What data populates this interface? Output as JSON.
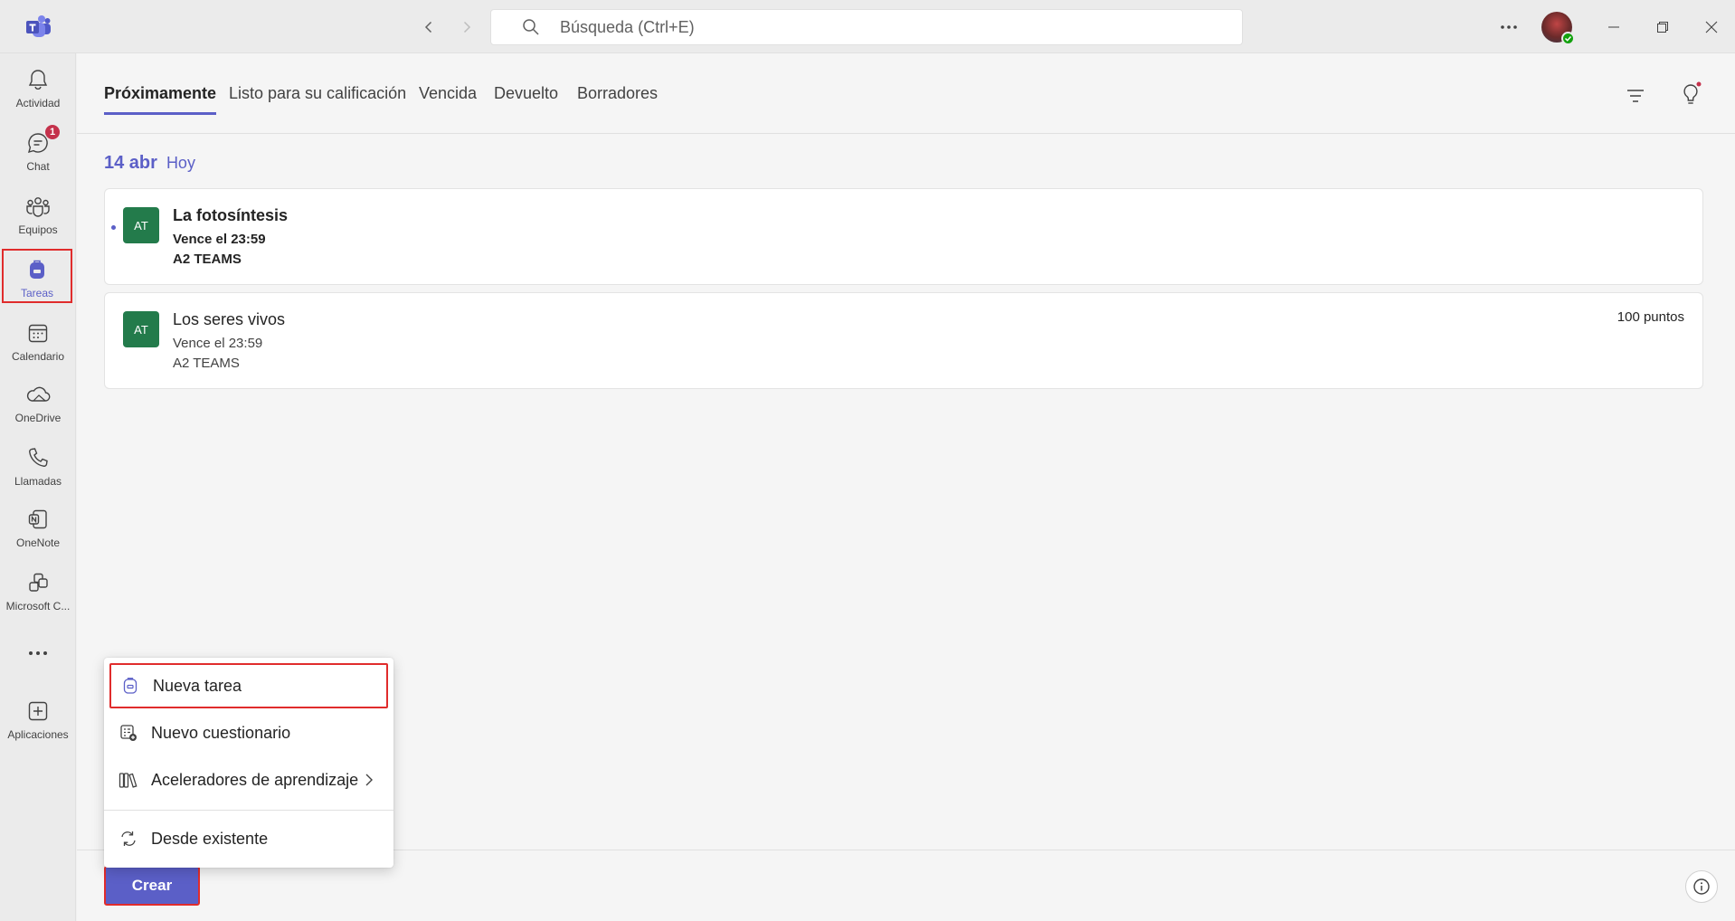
{
  "titlebar": {
    "search_placeholder": "Búsqueda (Ctrl+E)"
  },
  "rail": {
    "items": [
      {
        "label": "Actividad",
        "icon": "bell-icon"
      },
      {
        "label": "Chat",
        "icon": "chat-icon",
        "badge": "1"
      },
      {
        "label": "Equipos",
        "icon": "teams-icon"
      },
      {
        "label": "Tareas",
        "icon": "backpack-icon",
        "active": true
      },
      {
        "label": "Calendario",
        "icon": "calendar-icon"
      },
      {
        "label": "OneDrive",
        "icon": "cloud-icon"
      },
      {
        "label": "Llamadas",
        "icon": "phone-icon"
      },
      {
        "label": "OneNote",
        "icon": "onenote-icon"
      },
      {
        "label": "Microsoft C...",
        "icon": "copilot-icon"
      },
      {
        "label": "Aplicaciones",
        "icon": "add-apps-icon"
      }
    ]
  },
  "tabs": [
    {
      "label": "Próximamente",
      "active": true
    },
    {
      "label": "Listo para su calificación"
    },
    {
      "label": "Vencida"
    },
    {
      "label": "Devuelto"
    },
    {
      "label": "Borradores"
    }
  ],
  "date_group": {
    "date": "14 abr",
    "relative": "Hoy"
  },
  "assignments": [
    {
      "initials": "AT",
      "title": "La fotosíntesis",
      "due": "Vence el 23:59",
      "team": "A2 TEAMS",
      "points": "",
      "unread": true
    },
    {
      "initials": "AT",
      "title": "Los seres vivos",
      "due": "Vence el 23:59",
      "team": "A2 TEAMS",
      "points": "100 puntos",
      "unread": false
    }
  ],
  "create_menu": {
    "items": [
      {
        "label": "Nueva tarea",
        "icon": "backpack-icon"
      },
      {
        "label": "Nuevo cuestionario",
        "icon": "quiz-icon"
      },
      {
        "label": "Aceleradores de aprendizaje",
        "icon": "books-icon"
      },
      {
        "label": "Desde existente",
        "icon": "reuse-icon"
      }
    ]
  },
  "footer": {
    "create_label": "Crear"
  },
  "colors": {
    "accent": "#5b5fc7",
    "highlight_border": "#e02c2c",
    "class_avatar": "#237b4b",
    "badge": "#c4314b"
  }
}
